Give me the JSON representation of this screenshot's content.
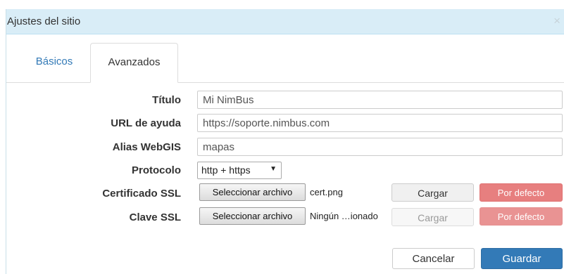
{
  "dialog": {
    "title": "Ajustes del sitio",
    "close_glyph": "×",
    "tabs": [
      {
        "label": "Básicos",
        "active": false
      },
      {
        "label": "Avanzados",
        "active": true
      }
    ],
    "form": {
      "title_label": "Título",
      "title_value": "Mi NimBus",
      "help_url_label": "URL de ayuda",
      "help_url_value": "https://soporte.nimbus.com",
      "webgis_label": "Alias WebGIS",
      "webgis_value": "mapas",
      "protocol_label": "Protocolo",
      "protocol_value": "http + https",
      "ssl_cert_label": "Certificado SSL",
      "ssl_cert_button": "Seleccionar archivo",
      "ssl_cert_file": "cert.png",
      "ssl_key_label": "Clave SSL",
      "ssl_key_button": "Seleccionar archivo",
      "ssl_key_file": "Ningún …ionado",
      "upload_label": "Cargar",
      "default_label": "Por defecto"
    },
    "footer": {
      "cancel_label": "Cancelar",
      "save_label": "Guardar"
    }
  },
  "colors": {
    "title_bar": "#d9edf7",
    "primary": "#337ab7",
    "danger": "#e77f7f",
    "link": "#337ab7"
  }
}
